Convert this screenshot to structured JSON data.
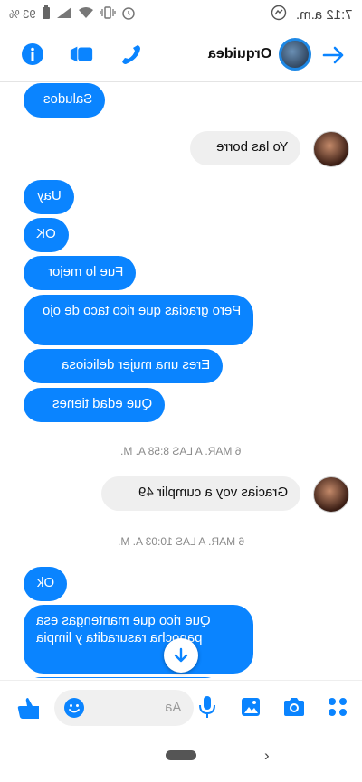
{
  "status_bar": {
    "time": "7:12 a.m.",
    "battery": "93 %"
  },
  "header": {
    "contact_name": "Orquideа"
  },
  "messages": {
    "m1": "Saludos",
    "m2": "Yo las borre",
    "m3": "Uay",
    "m4": "OK",
    "m5": "Fue lo mejor",
    "m6": "Pero gracias que rico taco de ojo",
    "m7": "Eres una mujer deliciosa",
    "m8": "Que edad tienes",
    "ts1": "6 MAR. A LAS 8:58 A. M.",
    "m9": "Gracias voy a cumplir 49",
    "ts2": "6 MAR. A LAS 10:03 A. M.",
    "m10": "Ok",
    "m11": "Que rico que mantengas esa panocha rasuradita y limpia"
  },
  "composer": {
    "placeholder": "Aa"
  },
  "colors": {
    "accent": "#0a84ff",
    "incoming_bubble": "#efefef"
  },
  "icons": [
    "info-icon",
    "video-call-icon",
    "phone-icon",
    "back-arrow-icon",
    "like-icon",
    "emoji-icon",
    "mic-icon",
    "gallery-icon",
    "camera-icon",
    "apps-icon",
    "scroll-down-icon"
  ]
}
